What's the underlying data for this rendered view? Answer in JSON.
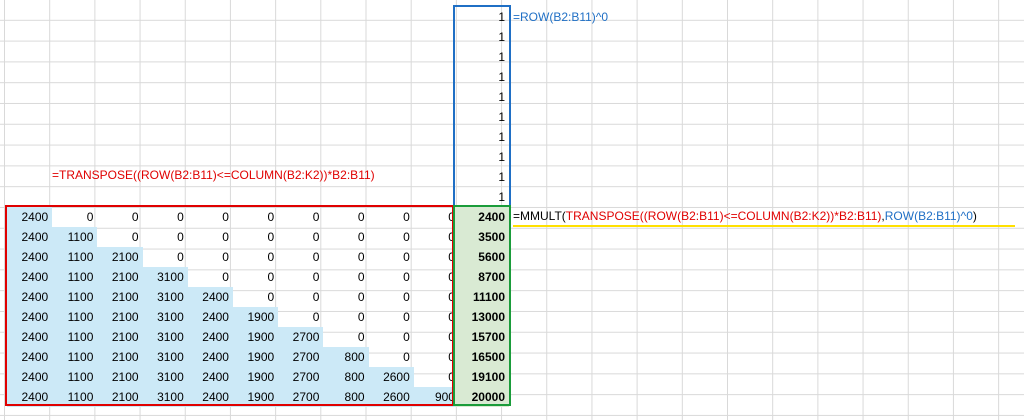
{
  "formulas": {
    "ones_column": "=ROW(B2:B11)^0",
    "transpose": "=TRANSPOSE((ROW(B2:B11)<=COLUMN(B2:K2))*B2:B11)",
    "mmult_prefix": "=MMULT(",
    "mmult_transpose": "TRANSPOSE((ROW(B2:B11)<=COLUMN(B2:K2))*B2:B11)",
    "mmult_comma": ",",
    "mmult_row": "ROW(B2:B11)^0",
    "mmult_suffix": ")"
  },
  "ones": [
    "1",
    "1",
    "1",
    "1",
    "1",
    "1",
    "1",
    "1",
    "1",
    "1"
  ],
  "matrix": [
    [
      "2400",
      "0",
      "0",
      "0",
      "0",
      "0",
      "0",
      "0",
      "0",
      "0"
    ],
    [
      "2400",
      "1100",
      "0",
      "0",
      "0",
      "0",
      "0",
      "0",
      "0",
      "0"
    ],
    [
      "2400",
      "1100",
      "2100",
      "0",
      "0",
      "0",
      "0",
      "0",
      "0",
      "0"
    ],
    [
      "2400",
      "1100",
      "2100",
      "3100",
      "0",
      "0",
      "0",
      "0",
      "0",
      "0"
    ],
    [
      "2400",
      "1100",
      "2100",
      "3100",
      "2400",
      "0",
      "0",
      "0",
      "0",
      "0"
    ],
    [
      "2400",
      "1100",
      "2100",
      "3100",
      "2400",
      "1900",
      "0",
      "0",
      "0",
      "0"
    ],
    [
      "2400",
      "1100",
      "2100",
      "3100",
      "2400",
      "1900",
      "2700",
      "0",
      "0",
      "0"
    ],
    [
      "2400",
      "1100",
      "2100",
      "3100",
      "2400",
      "1900",
      "2700",
      "800",
      "0",
      "0"
    ],
    [
      "2400",
      "1100",
      "2100",
      "3100",
      "2400",
      "1900",
      "2700",
      "800",
      "2600",
      "0"
    ],
    [
      "2400",
      "1100",
      "2100",
      "3100",
      "2400",
      "1900",
      "2700",
      "800",
      "2600",
      "900"
    ]
  ],
  "results": [
    "2400",
    "3500",
    "5600",
    "8700",
    "11100",
    "13000",
    "15700",
    "16500",
    "19100",
    "20000"
  ],
  "colors": {
    "matrix_border": "#e00000",
    "ones_border": "#1f6fc5",
    "result_border": "#1a9c3a",
    "underline": "#ffe000",
    "lower_triangle_fill": "#cce9f7",
    "result_fill": "#d9ead3"
  }
}
